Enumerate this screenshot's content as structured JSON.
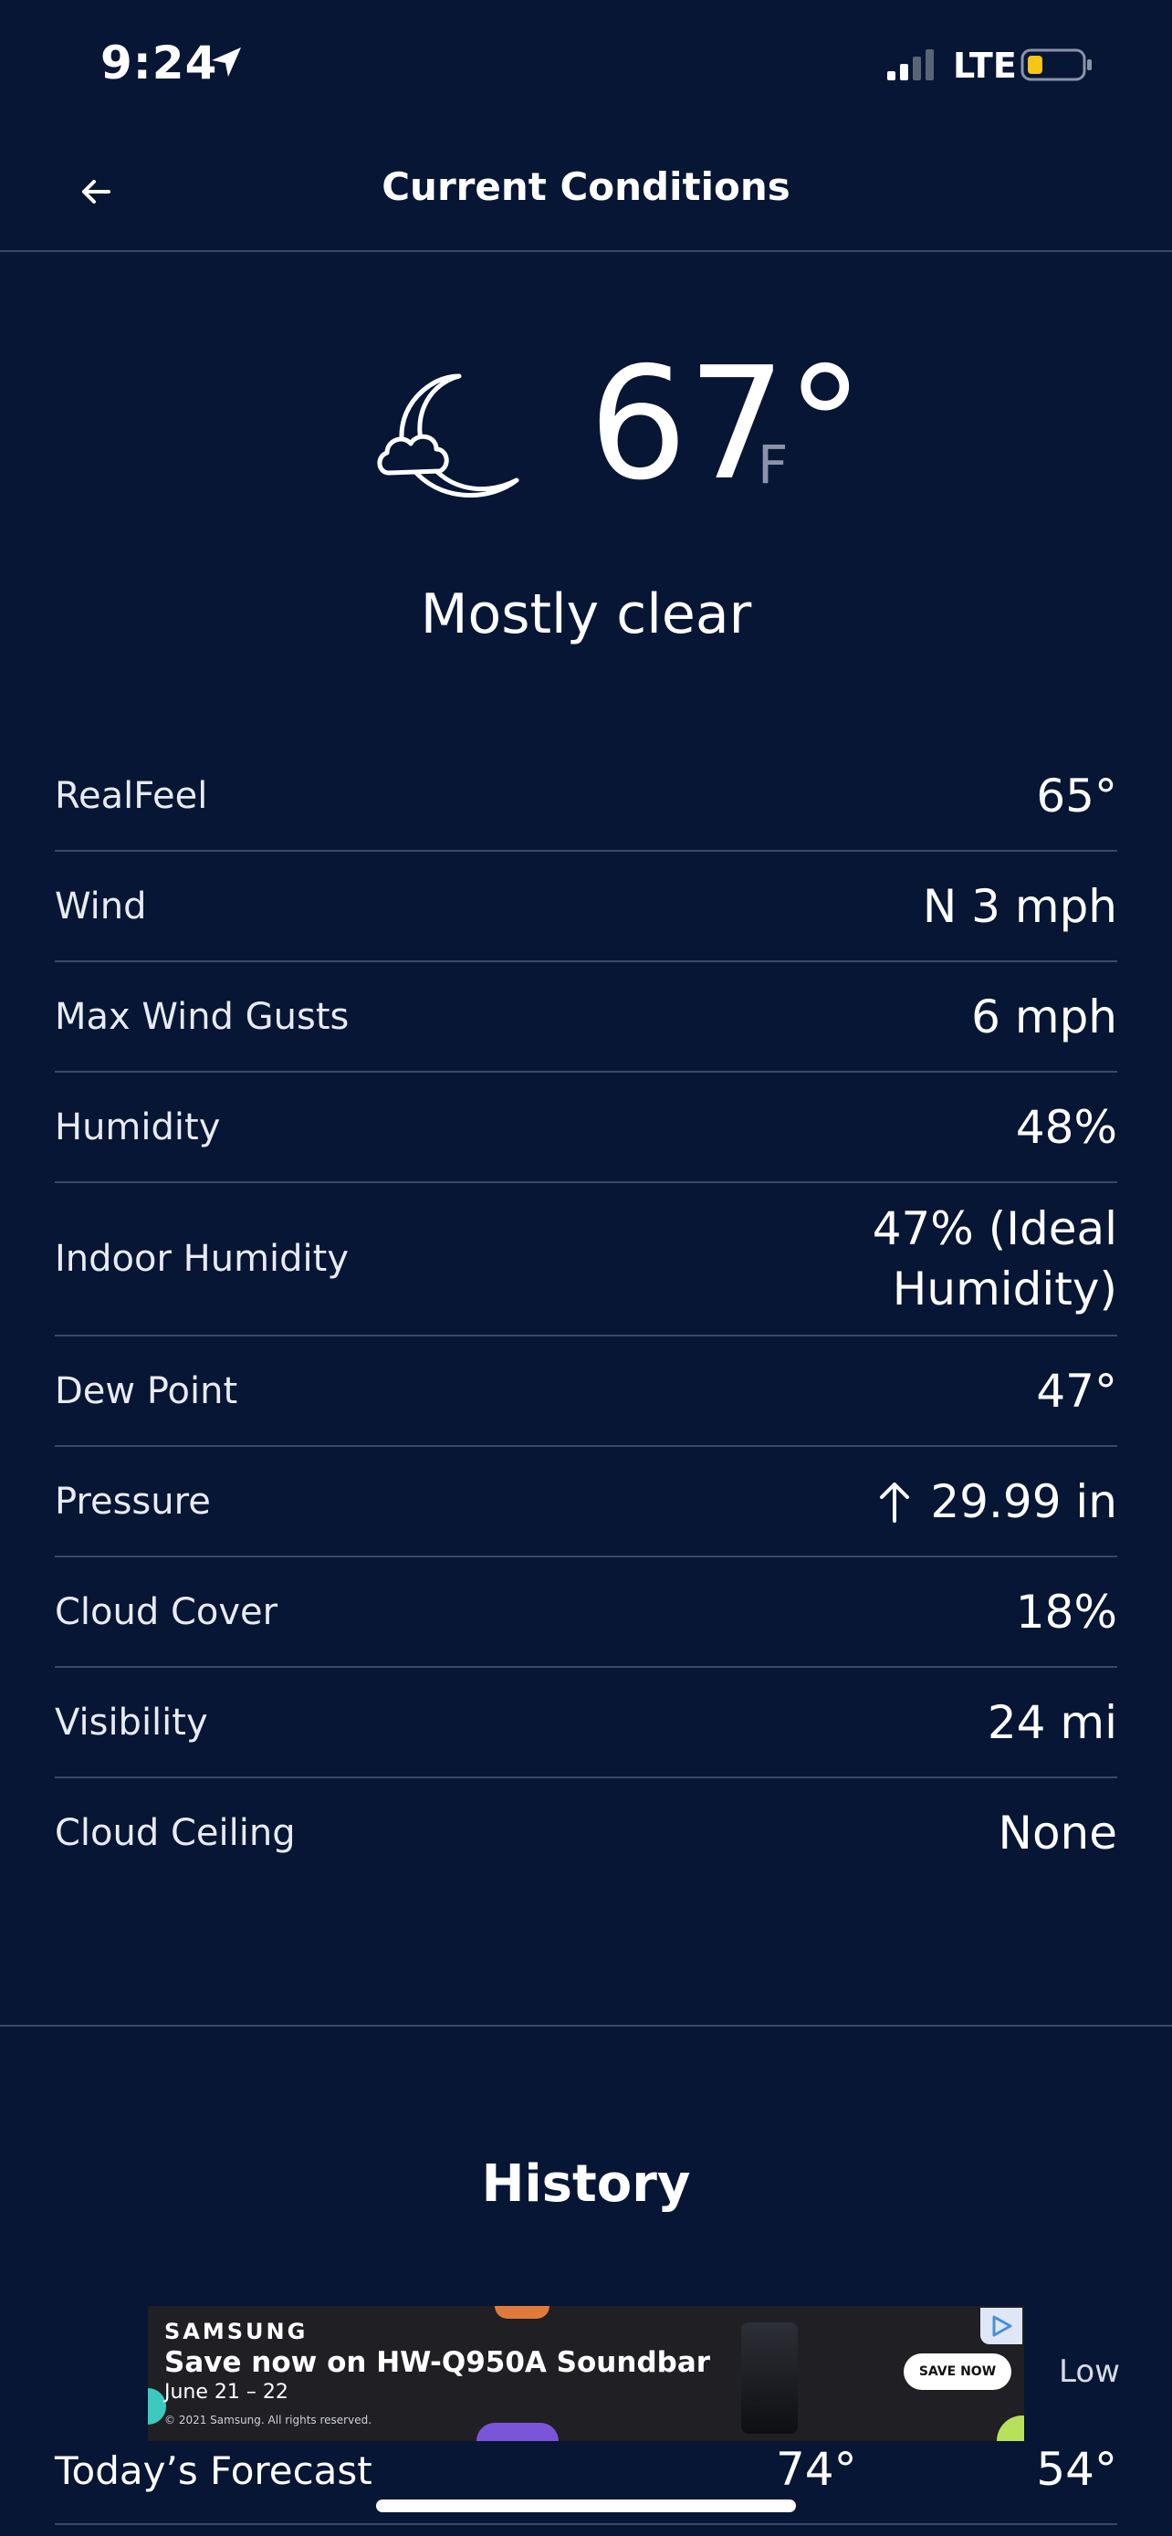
{
  "status_bar": {
    "time": "9:24",
    "network": "LTE"
  },
  "header": {
    "title": "Current Conditions"
  },
  "current": {
    "temperature": "67°",
    "unit": "F",
    "condition": "Mostly clear",
    "icon": "moon-cloud-icon"
  },
  "details": [
    {
      "label": "RealFeel",
      "value": "65°"
    },
    {
      "label": "Wind",
      "value": "N 3 mph"
    },
    {
      "label": "Max Wind Gusts",
      "value": "6 mph"
    },
    {
      "label": "Humidity",
      "value": "48%"
    },
    {
      "label": "Indoor Humidity",
      "value": "47% (Ideal Humidity)"
    },
    {
      "label": "Dew Point",
      "value": "47°"
    },
    {
      "label": "Pressure",
      "value": "29.99 in",
      "trend": "up"
    },
    {
      "label": "Cloud Cover",
      "value": "18%"
    },
    {
      "label": "Visibility",
      "value": "24 mi"
    },
    {
      "label": "Cloud Ceiling",
      "value": "None"
    }
  ],
  "history": {
    "title": "History",
    "low_header": "Low",
    "today": {
      "label": "Today’s Forecast",
      "high": "74°",
      "low": "54°"
    }
  },
  "ad": {
    "brand": "SAMSUNG",
    "headline": "Save now on HW-Q950A Soundbar",
    "dates": "June 21 – 22",
    "legal": "© 2021 Samsung. All rights reserved.",
    "cta": "SAVE NOW"
  },
  "colors": {
    "background": "#071635",
    "divider": "#3b4867",
    "text": "#ffffff",
    "battery_fill": "#f5c518"
  }
}
